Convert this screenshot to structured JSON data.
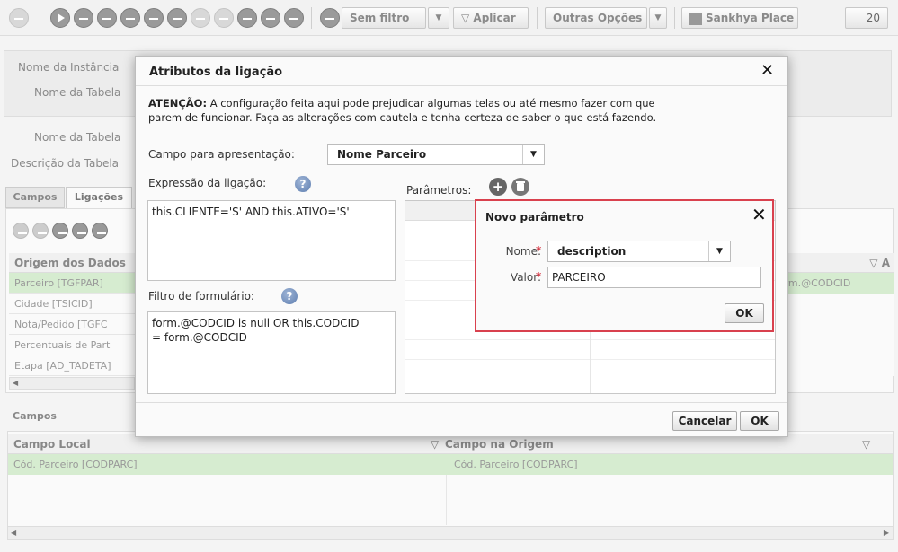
{
  "toolbar": {
    "filter_select": "Sem filtro",
    "apply_button": "Aplicar",
    "more_options": "Outras Opções",
    "place_button": "Sankhya Place",
    "page_size": "20"
  },
  "background": {
    "instance_name_label": "Nome da Instância",
    "table_name_label": "Nome da Tabela",
    "table_name_label2": "Nome da Tabela",
    "table_desc_label": "Descrição da Tabela",
    "tabs": [
      "Campos",
      "Ligações"
    ],
    "origins_header": "Origem dos Dados",
    "origins": [
      "Parceiro [TGFPAR]",
      "Cidade [TSICID]",
      "Nota/Pedido [TGFC",
      "Percentuais de Part",
      "Etapa [AD_TADETA]"
    ],
    "right_cell": "form.@CODCID",
    "fields_section": "Campos",
    "local_field_header": "Campo Local",
    "origin_field_header": "Campo na Origem",
    "local_field_value": "Cód. Parceiro [CODPARC]",
    "origin_field_value": "Cód. Parceiro [CODPARC]"
  },
  "dialog": {
    "title": "Atributos da ligação",
    "warning_strong": "ATENÇÃO:",
    "warning_line1": " A configuração feita aqui pode prejudicar algumas telas ou até mesmo fazer com que",
    "warning_line2": "parem de funcionar. Faça as alterações com cautela e tenha certeza de saber o que está fazendo.",
    "display_field_label": "Campo para apresentação:",
    "display_field_value": "Nome Parceiro",
    "expression_label": "Expressão da ligação:",
    "expression_value": "this.CLIENTE='S' AND this.ATIVO='S'",
    "filter_label": "Filtro de formulário:",
    "filter_line1": "form.@CODCID is null OR this.CODCID",
    "filter_line2": "= form.@CODCID",
    "params_label": "Parâmetros:",
    "cancel_button": "Cancelar",
    "ok_button": "OK"
  },
  "new_param": {
    "title": "Novo parâmetro",
    "name_label": "Nome:",
    "name_value": "description",
    "value_label": "Valor:",
    "value_value": "PARCEIRO",
    "required_mark": "*",
    "ok_button": "OK"
  }
}
